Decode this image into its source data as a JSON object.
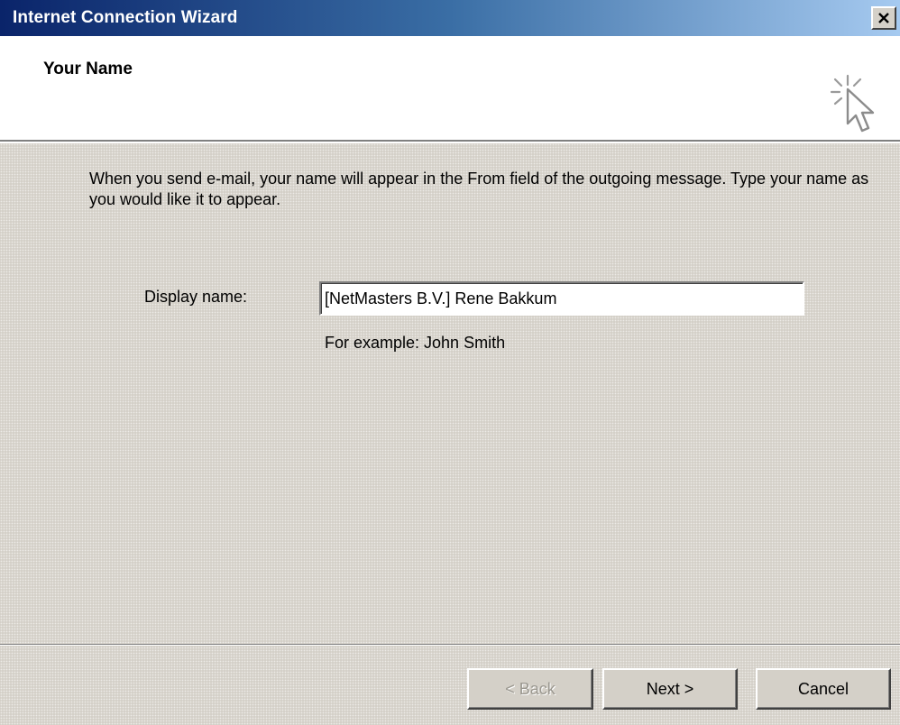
{
  "window": {
    "title": "Internet Connection Wizard",
    "close_glyph": "×"
  },
  "header": {
    "title": "Your Name",
    "icon": "wizard-cursor-icon"
  },
  "content": {
    "intro_text": "When you send e-mail, your name will appear in the From field of the outgoing message. Type your name as you would like it to appear.",
    "display_name": {
      "label": "Display name:",
      "value": "[NetMasters B.V.] Rene Bakkum",
      "hint": "For example: John Smith"
    }
  },
  "buttons": {
    "back": "< Back",
    "next": "Next >",
    "cancel": "Cancel"
  },
  "colors": {
    "title_bar_start": "#0a246a",
    "title_bar_end": "#a6caf0",
    "dialog_face": "#d4d0c8"
  }
}
